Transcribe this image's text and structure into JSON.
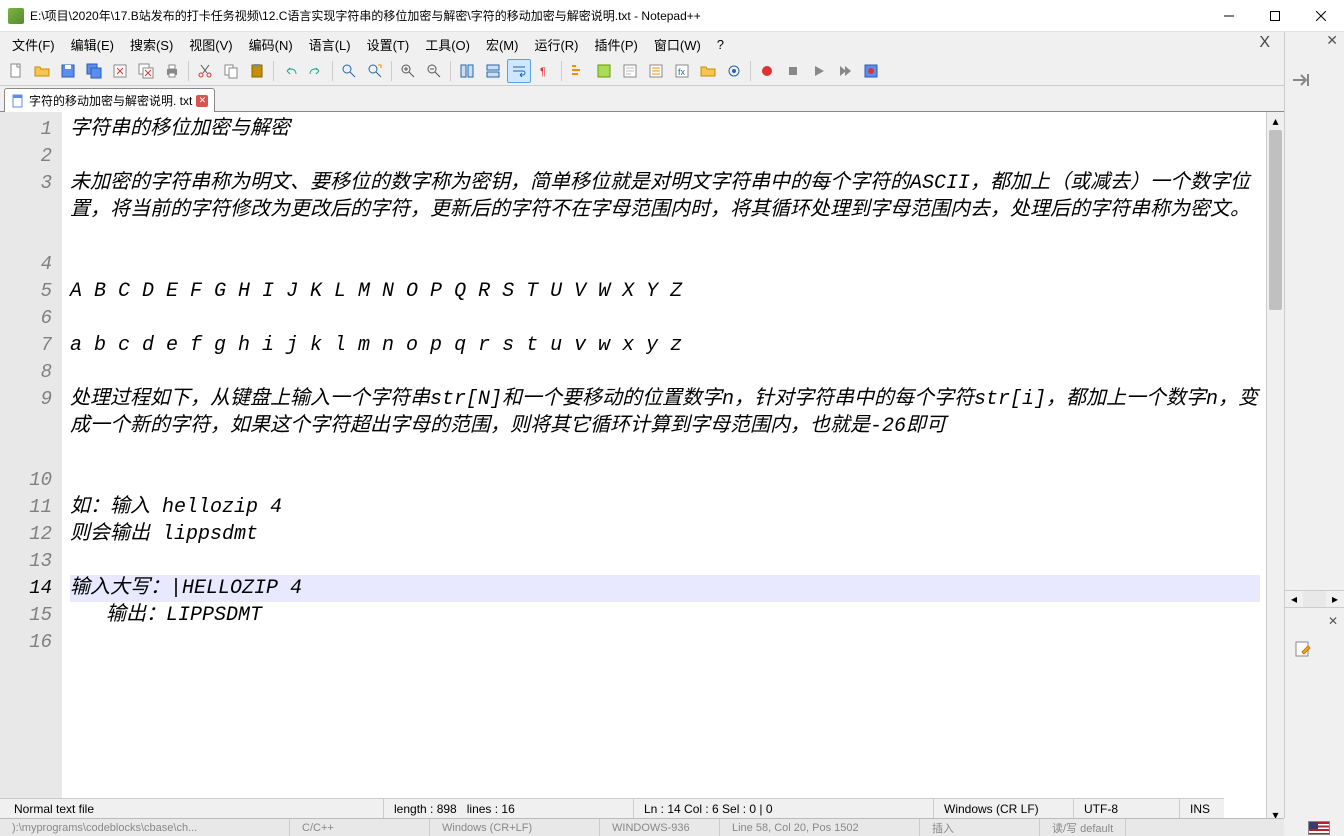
{
  "window": {
    "title": "E:\\项目\\2020年\\17.B站发布的打卡任务视频\\12.C语言实现字符串的移位加密与解密\\字符的移动加密与解密说明.txt - Notepad++"
  },
  "menu": {
    "items": [
      "文件(F)",
      "编辑(E)",
      "搜索(S)",
      "视图(V)",
      "编码(N)",
      "语言(L)",
      "设置(T)",
      "工具(O)",
      "宏(M)",
      "运行(R)",
      "插件(P)",
      "窗口(W)",
      "?"
    ]
  },
  "tab": {
    "name": "字符的移动加密与解密说明. txt"
  },
  "editor": {
    "lines": [
      {
        "n": 1,
        "text": "字符串的移位加密与解密"
      },
      {
        "n": 2,
        "text": ""
      },
      {
        "n": 3,
        "text": "未加密的字符串称为明文、要移位的数字称为密钥，简单移位就是对明文字符串中的每个字符的ASCII，都加上（或减去）一个数字位置，将当前的字符修改为更改后的字符，更新后的字符不在字母范围内时，将其循环处理到字母范围内去，处理后的字符串称为密文。"
      },
      {
        "n": 4,
        "text": ""
      },
      {
        "n": 5,
        "text": "A B C D E F G H I J K L M N O P Q R S T U V W X Y Z"
      },
      {
        "n": 6,
        "text": ""
      },
      {
        "n": 7,
        "text": "a b c d e f g h i j k l m n o p q r s t u v w x y z"
      },
      {
        "n": 8,
        "text": ""
      },
      {
        "n": 9,
        "text": "处理过程如下，从键盘上输入一个字符串str[N]和一个要移动的位置数字n，针对字符串中的每个字符str[i]，都加上一个数字n，变成一个新的字符，如果这个字符超出字母的范围，则将其它循环计算到字母范围内，也就是-26即可"
      },
      {
        "n": 10,
        "text": ""
      },
      {
        "n": 11,
        "text": "如：输入 hellozip 4"
      },
      {
        "n": 12,
        "text": "则会输出 lippsdmt"
      },
      {
        "n": 13,
        "text": ""
      },
      {
        "n": 14,
        "text": "输入大写：|HELLOZIP 4",
        "current": true
      },
      {
        "n": 15,
        "text": "   输出：LIPPSDMT"
      },
      {
        "n": 16,
        "text": ""
      }
    ]
  },
  "status": {
    "filetype": "Normal text file",
    "length": "length : 898",
    "lines": "lines : 16",
    "pos": "Ln : 14   Col : 6   Sel : 0 | 0",
    "eol": "Windows (CR LF)",
    "encoding": "UTF-8",
    "insmode": "INS"
  },
  "bottom": {
    "path": "):\\myprograms\\codeblocks\\cbase\\ch...",
    "lang": "C/C++",
    "eol": "Windows (CR+LF)",
    "enc": "WINDOWS-936",
    "pos": "Line 58, Col 20, Pos 1502",
    "ins": "插入",
    "rw": "读/写  default"
  }
}
